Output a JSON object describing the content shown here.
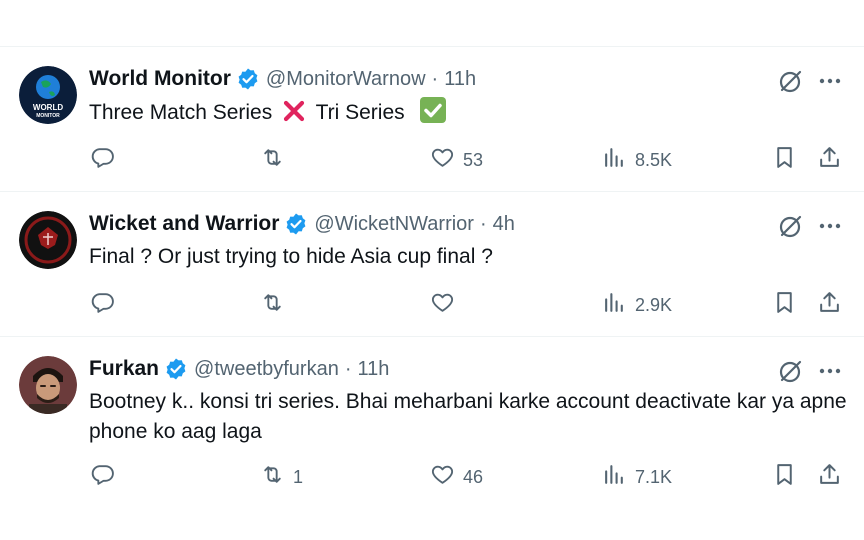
{
  "tweets": [
    {
      "name": "World Monitor",
      "handle": "@MonitorWarnow",
      "time": "11h",
      "text_parts": [
        "Three Match Series",
        "Tri Series"
      ],
      "emoji": [
        "cross-mark",
        "check-mark"
      ],
      "avatar_text": [
        "WORLD",
        "MONITOR"
      ],
      "replies": "",
      "reposts": "",
      "likes": "53",
      "views": "8.5K"
    },
    {
      "name": "Wicket and Warrior",
      "handle": "@WicketNWarrior",
      "time": "4h",
      "text": "Final ? Or just trying to hide Asia cup final ?",
      "replies": "",
      "reposts": "",
      "likes": "",
      "views": "2.9K"
    },
    {
      "name": "Furkan",
      "handle": "@tweetbyfurkan",
      "time": "11h",
      "text": "Bootney k.. konsi tri series. Bhai meharbani karke account deactivate kar ya apne phone ko aag laga",
      "replies": "",
      "reposts": "1",
      "likes": "46",
      "views": "7.1K"
    }
  ],
  "separator": "·",
  "colors": {
    "text": "#0f1419",
    "secondary": "#536471",
    "verified": "#1d9bf0",
    "divider": "#eff3f4"
  },
  "icons": [
    "verified-badge-icon",
    "grok-icon",
    "more-icon",
    "reply-icon",
    "repost-icon",
    "like-icon",
    "views-icon",
    "bookmark-icon",
    "share-icon"
  ]
}
